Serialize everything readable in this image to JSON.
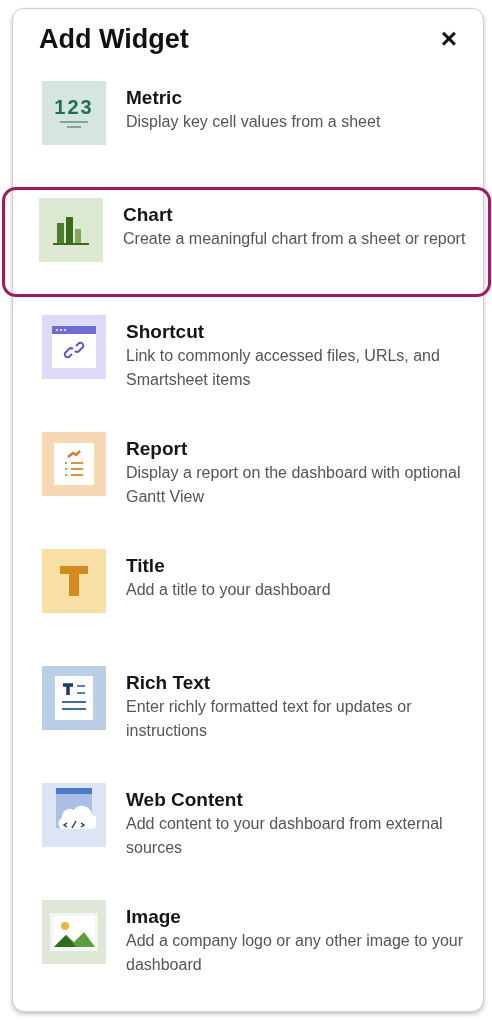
{
  "dialog": {
    "title": "Add Widget",
    "close": "×"
  },
  "widgets": [
    {
      "kind": "metric",
      "name": "Metric",
      "description": "Display key cell values from a sheet",
      "icon_text": "123",
      "selected": false
    },
    {
      "kind": "chart",
      "name": "Chart",
      "description": "Create a meaningful chart from a sheet or report",
      "selected": true
    },
    {
      "kind": "shortcut",
      "name": "Shortcut",
      "description": "Link to commonly accessed files, URLs, and Smartsheet items",
      "selected": false
    },
    {
      "kind": "report",
      "name": "Report",
      "description": "Display a report on the dashboard with optional Gantt View",
      "selected": false
    },
    {
      "kind": "title",
      "name": "Title",
      "description": "Add a title to your dashboard",
      "selected": false
    },
    {
      "kind": "richtext",
      "name": "Rich Text",
      "description": "Enter richly formatted text for updates or instructions",
      "selected": false
    },
    {
      "kind": "web",
      "name": "Web Content",
      "description": "Add content to your dashboard from external sources",
      "selected": false
    },
    {
      "kind": "image",
      "name": "Image",
      "description": "Add a company logo or any other image to your dashboard",
      "selected": false
    }
  ]
}
